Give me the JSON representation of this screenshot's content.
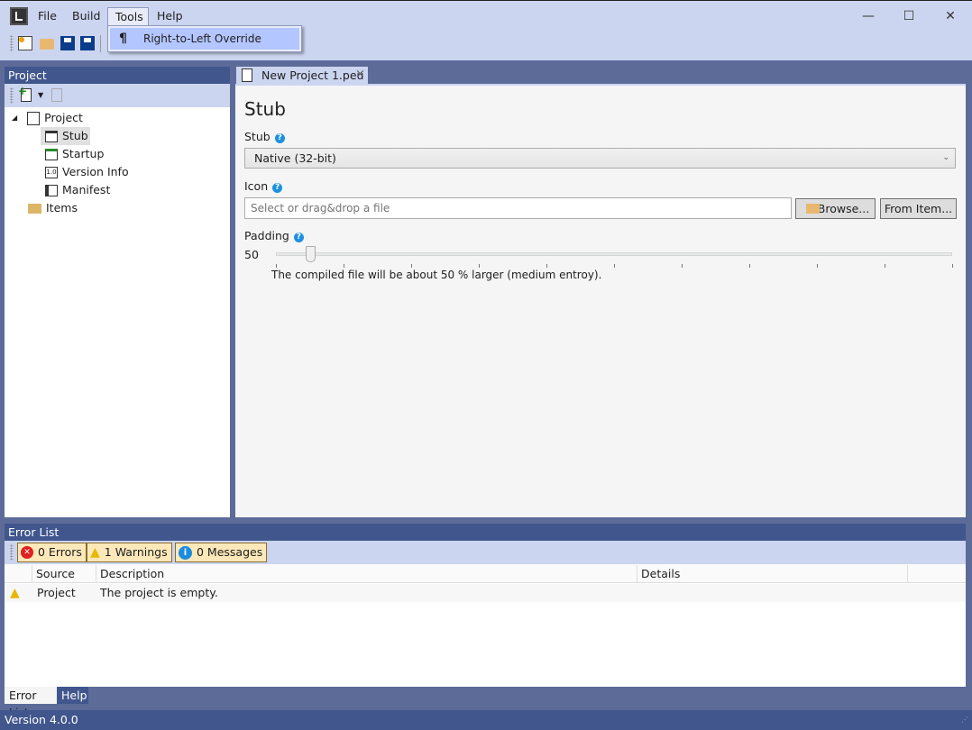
{
  "menu": {
    "items": [
      "File",
      "Build",
      "Tools",
      "Help"
    ],
    "open": "Tools",
    "dropdown": [
      {
        "icon": "pilcrow-icon",
        "glyph": "¶",
        "label": "Right-to-Left Override"
      }
    ]
  },
  "window": {
    "minimize": "—",
    "maximize": "☐",
    "close": "✕"
  },
  "project_panel": {
    "title": "Project",
    "tree": [
      {
        "label": "Project",
        "level": 0
      },
      {
        "label": "Stub",
        "level": 1,
        "selected": true
      },
      {
        "label": "Startup",
        "level": 1
      },
      {
        "label": "Version Info",
        "level": 1
      },
      {
        "label": "Manifest",
        "level": 1
      },
      {
        "label": "Items",
        "level": 0
      }
    ]
  },
  "document": {
    "tab": "New Project 1.peu",
    "tab_close": "×",
    "heading": "Stub",
    "stub": {
      "label": "Stub",
      "value": "Native (32-bit)"
    },
    "icon": {
      "label": "Icon",
      "placeholder": "Select or drag&drop a file",
      "browse": "Browse...",
      "from_item": "From Item..."
    },
    "padding": {
      "label": "Padding",
      "value": "50",
      "slider_fraction": 0.05,
      "note": "The compiled file will be about 50 % larger (medium entroy)."
    },
    "help_glyph": "?"
  },
  "error_list": {
    "title": "Error List",
    "filters": {
      "errors": "0 Errors",
      "warnings": "1 Warnings",
      "messages": "0 Messages"
    },
    "columns": [
      "Source",
      "Description",
      "Details"
    ],
    "rows": [
      {
        "type": "warning",
        "source": "Project",
        "description": "The project is empty.",
        "details": ""
      }
    ]
  },
  "bottom_tabs": [
    "Error List",
    "Help"
  ],
  "status": "Version 4.0.0",
  "colors": {
    "chrome": "#CCD5F0",
    "panel_header": "#40568D",
    "workspace": "#5D6B99",
    "menu_highlight": "#B4C6FF",
    "filter": "#FCE8B9"
  }
}
